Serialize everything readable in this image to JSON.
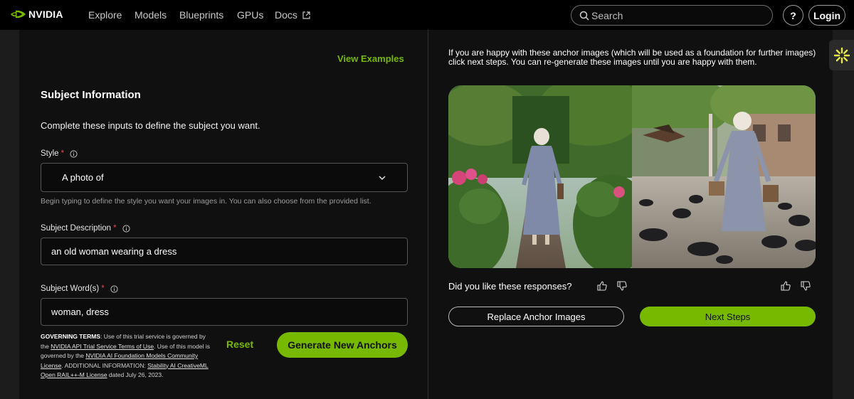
{
  "nav": {
    "logo_text": "NVIDIA",
    "links": [
      "Explore",
      "Models",
      "Blueprints",
      "GPUs",
      "Docs"
    ],
    "search_placeholder": "Search",
    "help_label": "?",
    "login_label": "Login"
  },
  "left": {
    "view_examples": "View Examples",
    "section_title": "Subject Information",
    "section_desc": "Complete these inputs to define the subject you want.",
    "style": {
      "label": "Style",
      "required_mark": "*",
      "value": "A photo of",
      "hint": "Begin typing to define the style you want your images in. You can also choose from the provided list."
    },
    "subject_description": {
      "label": "Subject Description",
      "required_mark": "*",
      "value": "an old woman wearing a dress"
    },
    "subject_words": {
      "label": "Subject Word(s)",
      "required_mark": "*",
      "value": "woman, dress"
    },
    "terms": {
      "heading": "GOVERNING TERMS",
      "t1": ": Use of this trial service is governed by the ",
      "link1": "NVIDIA API Trial Service Terms of Use",
      "t2": ". Use of this model is governed by the ",
      "link2": "NVIDIA AI Foundation Models Community License",
      "t3": ". ADDITIONAL INFORMATION: ",
      "link3": "Stability AI CreativeML Open RAIL++-M License",
      "t4": " dated July 26, 2023."
    },
    "reset_label": "Reset",
    "generate_label": "Generate New Anchors"
  },
  "right": {
    "instructions": "If you are happy with these anchor images (which will be used as a foundation for further images) click next steps. You can re-generate these images until you are happy with them.",
    "feedback_question": "Did you like these responses?",
    "replace_label": "Replace Anchor Images",
    "next_label": "Next Steps"
  },
  "colors": {
    "accent": "#76b900",
    "background": "#101010",
    "required": "#e5484d"
  },
  "icons": [
    "nvidia-logo-icon",
    "external-link-icon",
    "search-icon",
    "info-icon",
    "chevron-down-icon",
    "thumbs-up-icon",
    "thumbs-down-icon",
    "assistant-sparkle-icon"
  ]
}
